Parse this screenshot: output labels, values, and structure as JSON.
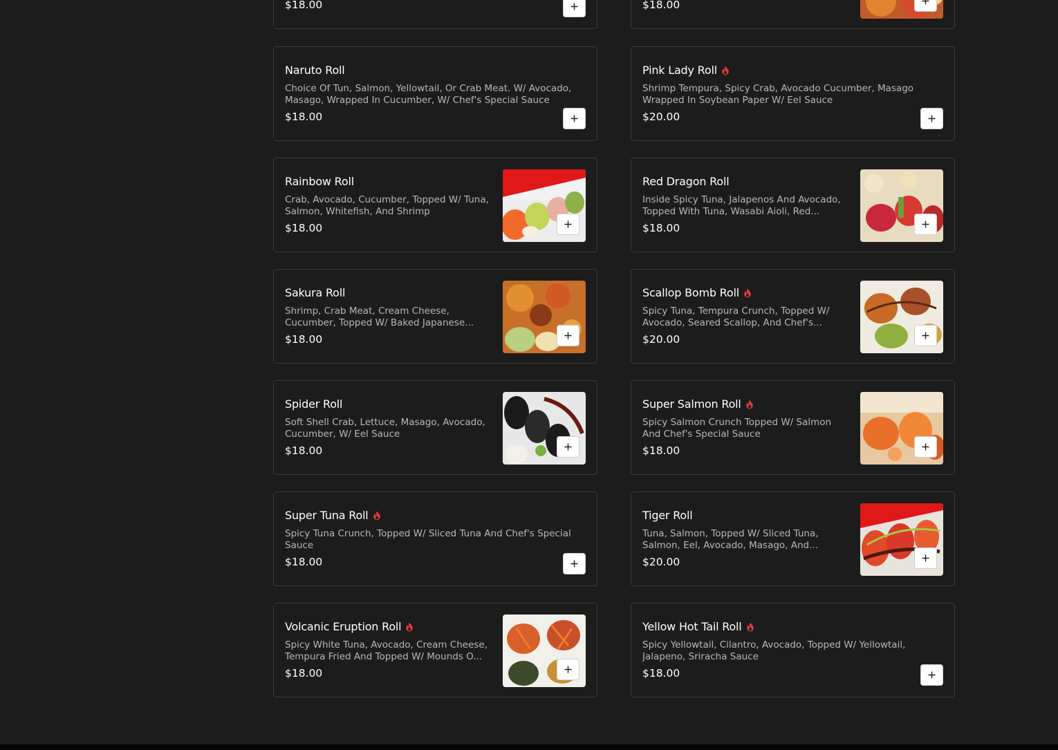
{
  "colors": {
    "background": "#1c1c1c",
    "card_border": "#3c3c3c",
    "spicy": "#e03a3a",
    "button": "#ffffff"
  },
  "icons": {
    "spicy": "flame-icon",
    "add": "plus-icon"
  },
  "items": [
    {
      "name": "",
      "desc": "",
      "price": "$18.00",
      "spicy": false,
      "image": false
    },
    {
      "name": "",
      "desc": "",
      "price": "$18.00",
      "spicy": false,
      "image": true
    },
    {
      "name": "Naruto Roll",
      "desc": "Choice Of Tun, Salmon, Yellowtail, Or Crab Meat. W/ Avocado, Masago, Wrapped In Cucumber, W/ Chef's Special Sauce",
      "price": "$18.00",
      "spicy": false,
      "image": false
    },
    {
      "name": "Pink Lady Roll",
      "desc": "Shrimp Tempura, Spicy Crab, Avocado Cucumber, Masago Wrapped In Soybean Paper W/ Eel Sauce",
      "price": "$20.00",
      "spicy": true,
      "image": false
    },
    {
      "name": "Rainbow Roll",
      "desc": "Crab, Avocado, Cucumber, Topped W/ Tuna, Salmon, Whitefish, And Shrimp",
      "price": "$18.00",
      "spicy": false,
      "image": true
    },
    {
      "name": "Red Dragon Roll",
      "desc": "Inside Spicy Tuna, Jalapenos And Avocado, Topped With Tuna, Wasabi Aioli, Red...",
      "price": "$18.00",
      "spicy": false,
      "image": true
    },
    {
      "name": "Sakura Roll",
      "desc": "Shrimp, Crab Meat, Cream Cheese, Cucumber, Topped W/ Baked Japanese...",
      "price": "$18.00",
      "spicy": false,
      "image": true
    },
    {
      "name": "Scallop Bomb Roll",
      "desc": "Spicy Tuna, Tempura Crunch, Topped W/ Avocado, Seared Scallop, And Chef's...",
      "price": "$20.00",
      "spicy": true,
      "image": true
    },
    {
      "name": "Spider Roll",
      "desc": "Soft Shell Crab, Lettuce, Masago, Avocado, Cucumber, W/ Eel Sauce",
      "price": "$18.00",
      "spicy": false,
      "image": true
    },
    {
      "name": "Super Salmon Roll",
      "desc": "Spicy Salmon Crunch Topped W/ Salmon And Chef's Special Sauce",
      "price": "$18.00",
      "spicy": true,
      "image": true
    },
    {
      "name": "Super Tuna Roll",
      "desc": "Spicy Tuna Crunch, Topped W/ Sliced Tuna And Chef's Special Sauce",
      "price": "$18.00",
      "spicy": true,
      "image": false
    },
    {
      "name": "Tiger Roll",
      "desc": "Tuna, Salmon, Topped W/ Sliced Tuna, Salmon, Eel, Avocado, Masago, And...",
      "price": "$20.00",
      "spicy": false,
      "image": true
    },
    {
      "name": "Volcanic Eruption Roll",
      "desc": "Spicy White Tuna, Avocado, Cream Cheese, Tempura Fried And Topped W/ Mounds O...",
      "price": "$18.00",
      "spicy": true,
      "image": true
    },
    {
      "name": "Yellow Hot Tail Roll",
      "desc": "Spicy Yellowtail, Cilantro, Avocado, Topped W/ Yellowtail, Jalapeno, Sriracha Sauce",
      "price": "$18.00",
      "spicy": true,
      "image": false
    }
  ]
}
